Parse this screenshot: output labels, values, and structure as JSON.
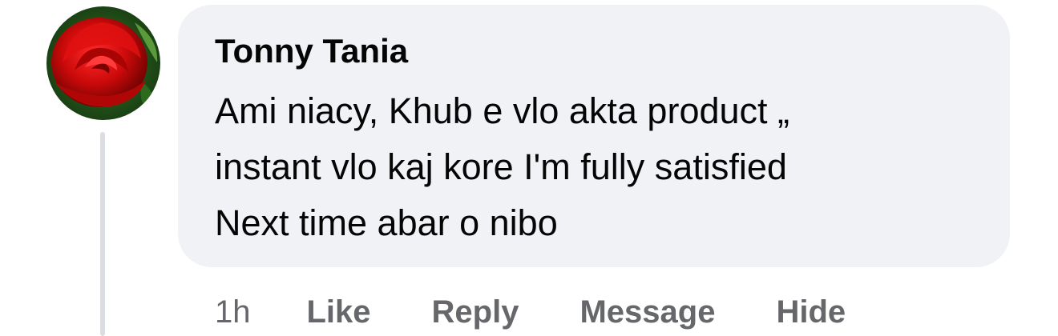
{
  "comment": {
    "author": "Tonny Tania",
    "text_lines": [
      "Ami niacy, Khub e vlo akta product „",
      "instant vlo kaj kore I'm fully satisfied",
      "Next time abar o nibo"
    ],
    "timestamp": "1h",
    "actions": {
      "like": "Like",
      "reply": "Reply",
      "message": "Message",
      "hide": "Hide"
    }
  },
  "colors": {
    "bubble": "#f0f2f5",
    "text": "#050505",
    "secondary_text": "#65676b",
    "thread_line": "#dadde1"
  },
  "icons": {
    "avatar": "red-rose-image"
  }
}
